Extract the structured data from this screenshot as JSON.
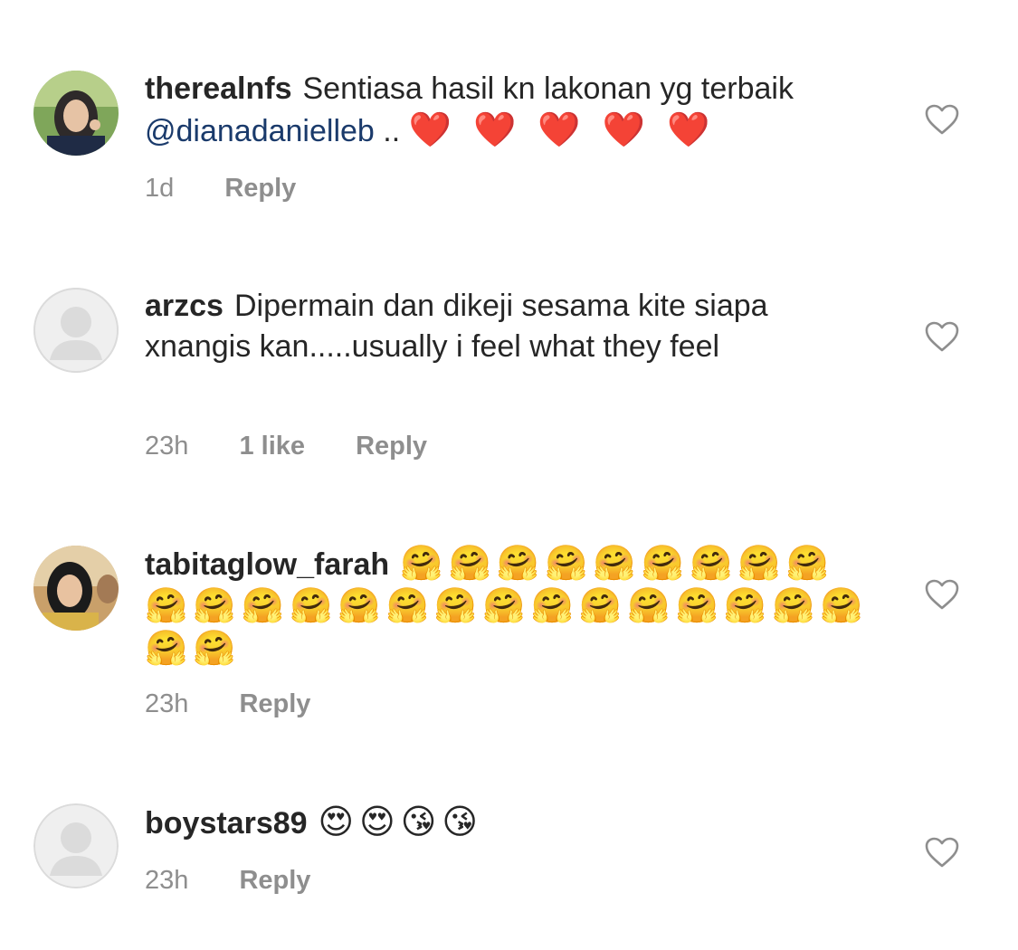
{
  "comments": [
    {
      "username": "therealnfs",
      "text_before": "Sentiasa hasil kn lakonan yg terbaik ",
      "mention": "@dianadanielleb",
      "text_after": " .. ",
      "emojis": "❤️ ❤️ ❤️ ❤️ ❤️",
      "time": "1d",
      "likes": "",
      "reply_label": "Reply",
      "avatar_icon": "profile-photo-hijab"
    },
    {
      "username": "arzcs",
      "text_before": "Dipermain dan dikeji sesama kite siapa xnangis kan.....usually i feel what they feel",
      "mention": "",
      "text_after": "",
      "emojis": "",
      "time": "23h",
      "likes": "1 like",
      "reply_label": "Reply",
      "avatar_icon": "default-avatar-icon"
    },
    {
      "username": "tabitaglow_farah",
      "text_before": "",
      "mention": "",
      "text_after": "",
      "emojis": "🤗🤗🤗🤗🤗🤗🤗🤗🤗🤗🤗🤗🤗🤗🤗🤗🤗🤗🤗🤗🤗🤗🤗🤗🤗🤗",
      "time": "23h",
      "likes": "",
      "reply_label": "Reply",
      "avatar_icon": "profile-photo-hijab"
    },
    {
      "username": "boystars89",
      "text_before": "",
      "mention": "",
      "text_after": "",
      "emojis": "😍😍😘😘",
      "time": "23h",
      "likes": "",
      "reply_label": "Reply",
      "avatar_icon": "default-avatar-icon"
    }
  ],
  "colors": {
    "text": "#262626",
    "meta": "#8e8e8e",
    "mention": "#1a3a6b",
    "heart_outline": "#8e8e8e"
  },
  "icons": {
    "like": "heart-outline-icon"
  }
}
